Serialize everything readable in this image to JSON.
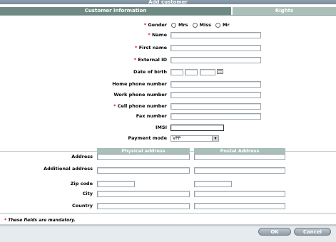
{
  "dialog": {
    "title": "Add customer"
  },
  "tabs": [
    {
      "label": "Customer information"
    },
    {
      "label": "Rights"
    }
  ],
  "form": {
    "gender": {
      "label": "Gender",
      "options": [
        "Mrs",
        "Miss",
        "Mr"
      ]
    },
    "name": {
      "label": "Name",
      "value": ""
    },
    "first_name": {
      "label": "First name",
      "value": ""
    },
    "external_id": {
      "label": "External ID",
      "value": ""
    },
    "date_of_birth": {
      "label": "Date of birth",
      "day": "",
      "month": "",
      "year": ""
    },
    "home_phone": {
      "label": "Home phone number",
      "value": ""
    },
    "work_phone": {
      "label": "Work phone number",
      "value": ""
    },
    "cell_phone": {
      "label": "Cell phone number",
      "value": ""
    },
    "fax": {
      "label": "Fax number",
      "value": ""
    },
    "imsi": {
      "label": "IMSI",
      "value": ""
    },
    "payment_mode": {
      "label": "Payment mode",
      "selected": "VPP"
    },
    "required_marker": "*"
  },
  "address": {
    "headers": {
      "physical": "Physical address",
      "postal": "Postal Address"
    },
    "rows": [
      {
        "label": "Address"
      },
      {
        "label": "Additional address"
      },
      {
        "label": "Zip code"
      },
      {
        "label": "City"
      },
      {
        "label": "Country"
      }
    ]
  },
  "footer": {
    "note": "These fields are mandatory.",
    "ok_label": "OK",
    "cancel_label": "Cancel"
  },
  "icons": {
    "calendar": "calendar-icon",
    "dropdown": "chevron-down-icon"
  },
  "colors": {
    "required": "#e0001a",
    "tab_active": "#6f8a84",
    "tab_inactive": "#a9bfb8"
  }
}
